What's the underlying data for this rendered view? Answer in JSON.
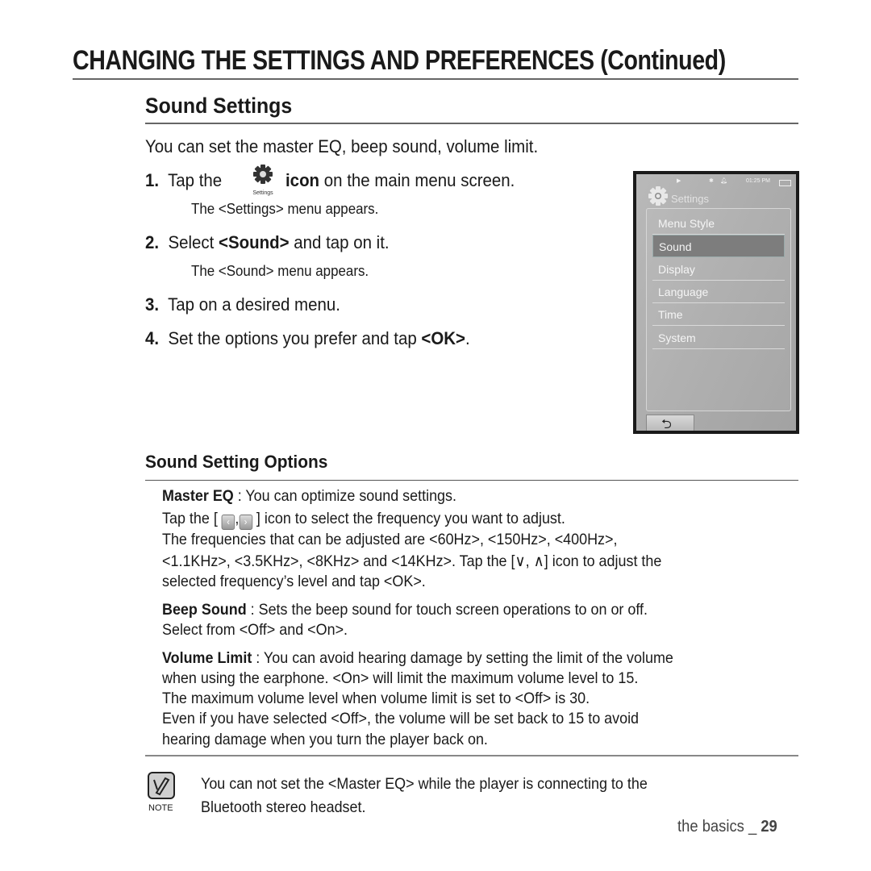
{
  "header": {
    "title": "CHANGING THE SETTINGS AND PREFERENCES (Continued)",
    "section_title": "Sound Settings",
    "intro": "You can set the master EQ, beep sound, volume limit."
  },
  "steps": [
    {
      "num": "1.",
      "pre": "Tap the",
      "bold": "icon",
      "post": "on the main menu screen.",
      "icon": "settings-gear-icon",
      "icon_label": "Settings",
      "sub": "The <Settings> menu appears."
    },
    {
      "num": "2.",
      "pre": "Select",
      "bold": "<Sound>",
      "post": "and tap on it.",
      "sub": "The <Sound> menu appears."
    },
    {
      "num": "3.",
      "pre": "Tap on a desired menu.",
      "bold": "",
      "post": ""
    },
    {
      "num": "4.",
      "pre": "Set the options you prefer and tap",
      "bold": "<OK>",
      "post": "."
    }
  ],
  "device": {
    "status_time": "01:25 PM",
    "status_icons": [
      "play-icon",
      "bluetooth-icon",
      "bell-icon",
      "battery-icon"
    ],
    "screen_title": "Settings",
    "menu_items": [
      "Menu Style",
      "Sound",
      "Display",
      "Language",
      "Time",
      "System"
    ],
    "selected_item": "Sound",
    "back_glyph": "⮌"
  },
  "options": {
    "title": "Sound Setting Options",
    "master_eq": {
      "label": "Master EQ",
      "line1": " : You can optimize sound settings.",
      "line2_pre": "Tap the [",
      "line2_post": "] icon to select the frequency you want to adjust.",
      "line3": "The frequencies that can be adjusted are <60Hz>, <150Hz>, <400Hz>,",
      "line4_pre": "<1.1KHz>, <3.5KHz>, <8KHz> and <14KHz>. Tap the [",
      "line4_glyphs": "∨, ∧",
      "line4_post": "] icon to adjust the",
      "line5": "selected frequency’s level and tap <OK>."
    },
    "beep_sound": {
      "label": "Beep Sound",
      "line1": " : Sets the beep sound for touch screen operations to on or off.",
      "line2": "Select from <Off> and <On>."
    },
    "volume_limit": {
      "label": "Volume Limit",
      "line1": " : You can avoid hearing damage by setting the limit of the volume",
      "line2": "when using the earphone. <On> will limit the maximum volume level to 15.",
      "line3": "The maximum volume level when volume limit is set to <Off> is 30.",
      "line4": "Even if you have selected <Off>, the volume will be set back to 15 to avoid",
      "line5": "hearing damage when you turn the player back on."
    }
  },
  "note": {
    "label": "NOTE",
    "line1": "You can not set the <Master EQ> while the player is connecting to the",
    "line2": "Bluetooth stereo headset."
  },
  "footer": {
    "section": "the basics _ ",
    "page": "29"
  }
}
